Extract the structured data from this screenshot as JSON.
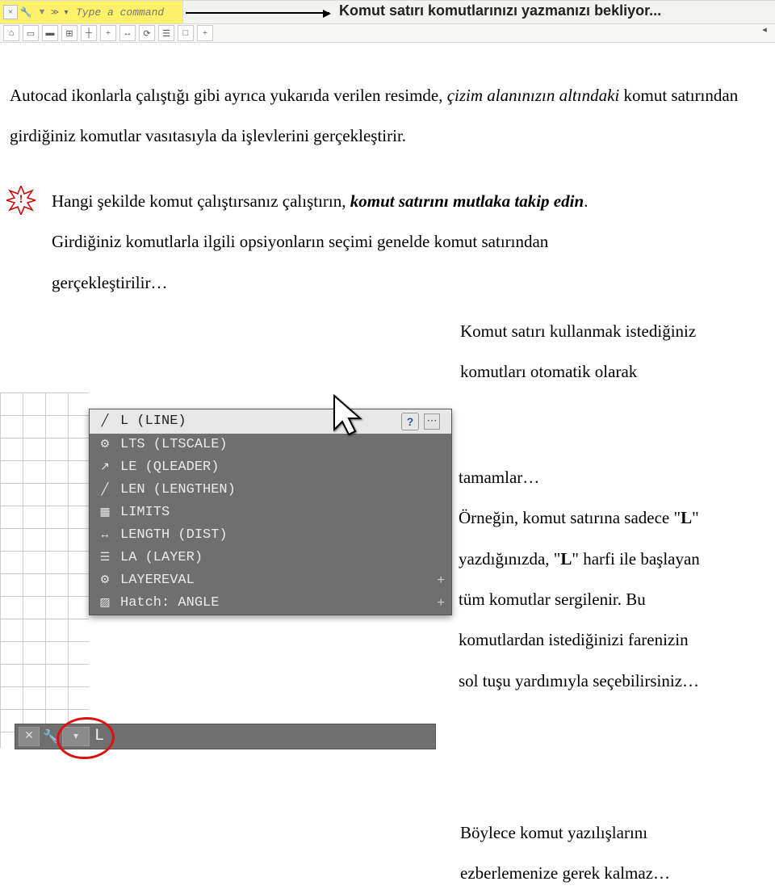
{
  "cmdbar": {
    "close_icon": "×",
    "wrench_icon": "🔧",
    "chevron_icon": "▼",
    "prompt_icon1": "≫",
    "prompt_icon2": "▾",
    "input_placeholder": "Type a command",
    "callout": "Komut satırı komutlarınızı yazmanızı bekliyor..."
  },
  "toolbar": {
    "icons": [
      "⌂",
      "▭",
      "▬",
      "⊞",
      "┼",
      "+",
      "↔",
      "⟳",
      "☰",
      "□",
      "+"
    ]
  },
  "paragraphs": {
    "p1_a": "Autocad ikonlarla çalıştığı gibi ayrıca yukarıda verilen resimde, ",
    "p1_b": "çizim alanınızın altındaki",
    "p1_c": " ",
    "p1_d": "komut satırından girdiğiniz komutlar vasıtasıyla da işlevlerini gerçekleştirir."
  },
  "bang": {
    "mark": "!",
    "line1_a": "Hangi şekilde komut çalıştırsanız çalıştırın, ",
    "line1_b": "komut satırını mutlaka takip edin",
    "line1_c": ".",
    "line2": "Girdiğiniz komutlarla ilgili opsiyonların seçimi genelde komut satırından",
    "line3": "gerçekleştirilir…"
  },
  "right": {
    "l1": "Komut satırı kullanmak istediğiniz",
    "l2": "komutları otomatik olarak",
    "l3": "tamamlar…",
    "l4a": "Örneğin, komut satırına sadece \"",
    "l4b": "L",
    "l4c": "\"",
    "l5a": "yazdığınızda, \"",
    "l5b": "L",
    "l5c": "\" harfi ile başlayan",
    "l6": "tüm komutlar sergilenir. Bu",
    "l7": "komutlardan istediğinizi farenizin",
    "l8": "sol tuşu yardımıyla seçebilirsiniz…",
    "l9": "Böylece komut yazılışlarını",
    "l10": "ezberlemenize gerek kalmaz…"
  },
  "autocomplete": {
    "items": [
      {
        "icon": "╱",
        "label": "L (LINE)",
        "selected": true,
        "help": true,
        "dots": true
      },
      {
        "icon": "⚙",
        "label": "LTS (LTSCALE)",
        "selected": false
      },
      {
        "icon": "↗",
        "label": "LE (QLEADER)",
        "selected": false
      },
      {
        "icon": "╱",
        "label": "LEN (LENGTHEN)",
        "selected": false
      },
      {
        "icon": "▦",
        "label": "LIMITS",
        "selected": false
      },
      {
        "icon": "↔",
        "label": "LENGTH (DIST)",
        "selected": false
      },
      {
        "icon": "☰",
        "label": "LA (LAYER)",
        "selected": false
      },
      {
        "icon": "⚙",
        "label": "LAYEREVAL",
        "selected": false,
        "plus": true
      },
      {
        "icon": "▨",
        "label": "Hatch: ANGLE",
        "selected": false,
        "plus": true
      }
    ],
    "cmdline": {
      "close": "✕",
      "wrench": "🔧",
      "pill": "▾",
      "text": "L"
    }
  }
}
